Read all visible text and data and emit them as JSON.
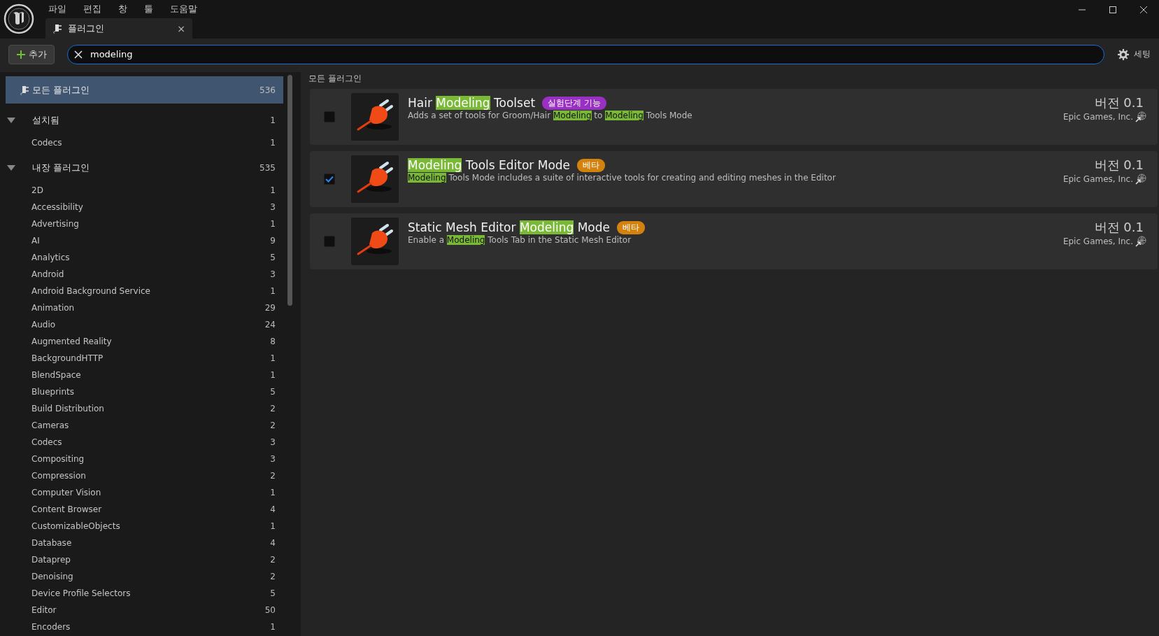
{
  "menu": [
    "파일",
    "편집",
    "창",
    "툴",
    "도움말"
  ],
  "tab": {
    "label": "플러그인",
    "close": "×",
    "selected": true
  },
  "toolbar": {
    "add_label": "추가",
    "search_value": "modeling",
    "settings_label": "세팅"
  },
  "sidebar": {
    "all": {
      "label": "모든 플러그인",
      "count": "536",
      "selected": true
    },
    "groups": [
      {
        "label": "설치됨",
        "count": "1",
        "expanded": true,
        "children": [
          {
            "label": "Codecs",
            "count": "1",
            "selected": false
          }
        ]
      },
      {
        "label": "내장 플러그인",
        "count": "535",
        "expanded": true,
        "children": [
          {
            "label": "2D",
            "count": "1",
            "selected": false
          },
          {
            "label": "Accessibility",
            "count": "3",
            "selected": false
          },
          {
            "label": "Advertising",
            "count": "1",
            "selected": false
          },
          {
            "label": "AI",
            "count": "9",
            "selected": false
          },
          {
            "label": "Analytics",
            "count": "5",
            "selected": false
          },
          {
            "label": "Android",
            "count": "3",
            "selected": false
          },
          {
            "label": "Android Background Service",
            "count": "1",
            "selected": false
          },
          {
            "label": "Animation",
            "count": "29",
            "selected": false
          },
          {
            "label": "Audio",
            "count": "24",
            "selected": false
          },
          {
            "label": "Augmented Reality",
            "count": "8",
            "selected": false
          },
          {
            "label": "BackgroundHTTP",
            "count": "1",
            "selected": false
          },
          {
            "label": "BlendSpace",
            "count": "1",
            "selected": false
          },
          {
            "label": "Blueprints",
            "count": "5",
            "selected": false
          },
          {
            "label": "Build Distribution",
            "count": "2",
            "selected": false
          },
          {
            "label": "Cameras",
            "count": "2",
            "selected": false
          },
          {
            "label": "Codecs",
            "count": "3",
            "selected": false
          },
          {
            "label": "Compositing",
            "count": "3",
            "selected": false
          },
          {
            "label": "Compression",
            "count": "2",
            "selected": false
          },
          {
            "label": "Computer Vision",
            "count": "1",
            "selected": false
          },
          {
            "label": "Content Browser",
            "count": "4",
            "selected": false
          },
          {
            "label": "CustomizableObjects",
            "count": "1",
            "selected": false
          },
          {
            "label": "Database",
            "count": "4",
            "selected": false
          },
          {
            "label": "Dataprep",
            "count": "2",
            "selected": false
          },
          {
            "label": "Denoising",
            "count": "2",
            "selected": false
          },
          {
            "label": "Device Profile Selectors",
            "count": "5",
            "selected": false
          },
          {
            "label": "Editor",
            "count": "50",
            "selected": false
          },
          {
            "label": "Encoders",
            "count": "1",
            "selected": false
          }
        ]
      }
    ]
  },
  "section_label": "모든 플러그인",
  "plugins": [
    {
      "enabled": false,
      "title": [
        {
          "text": "Hair ",
          "highlight": false
        },
        {
          "text": "Modeling",
          "highlight": true
        },
        {
          "text": " Toolset",
          "highlight": false
        }
      ],
      "badge": {
        "label": "실험단계 기능",
        "color": "#9a2fc4"
      },
      "description": [
        {
          "text": "Adds a set of tools for Groom/Hair ",
          "highlight": false
        },
        {
          "text": "Modeling",
          "highlight": true
        },
        {
          "text": " to ",
          "highlight": false
        },
        {
          "text": "Modeling",
          "highlight": true
        },
        {
          "text": " Tools Mode",
          "highlight": false
        }
      ],
      "version": "버전 0.1",
      "publisher": "Epic Games, Inc."
    },
    {
      "enabled": true,
      "title": [
        {
          "text": "Modeling",
          "highlight": true
        },
        {
          "text": " Tools Editor Mode",
          "highlight": false
        }
      ],
      "badge": {
        "label": "베타",
        "color": "#d4820e"
      },
      "description": [
        {
          "text": "Modeling",
          "highlight": true
        },
        {
          "text": " Tools Mode includes a suite of interactive tools for creating and editing meshes in the Editor",
          "highlight": false
        }
      ],
      "version": "버전 0.1",
      "publisher": "Epic Games, Inc."
    },
    {
      "enabled": false,
      "title": [
        {
          "text": "Static Mesh Editor ",
          "highlight": false
        },
        {
          "text": "Modeling",
          "highlight": true
        },
        {
          "text": " Mode",
          "highlight": false
        }
      ],
      "badge": {
        "label": "베타",
        "color": "#d4820e"
      },
      "description": [
        {
          "text": "Enable a ",
          "highlight": false
        },
        {
          "text": "Modeling",
          "highlight": true
        },
        {
          "text": " Tools Tab in the Static Mesh Editor",
          "highlight": false
        }
      ],
      "version": "버전 0.1",
      "publisher": "Epic Games, Inc."
    }
  ]
}
